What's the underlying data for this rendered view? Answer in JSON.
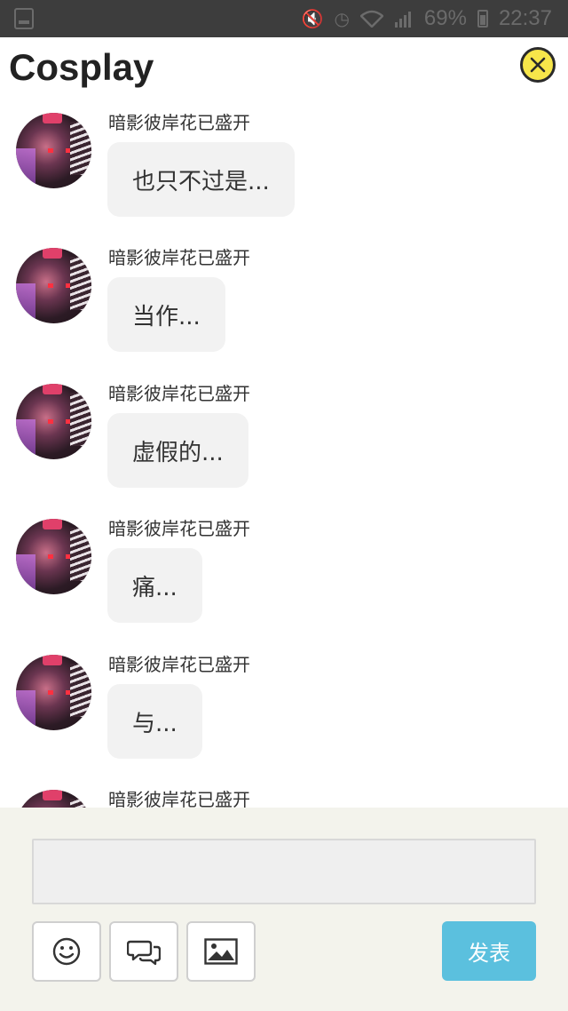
{
  "status_bar": {
    "battery": "69%",
    "time": "22:37",
    "icons": [
      "screenshot-icon",
      "mute-icon",
      "alarm-icon",
      "wifi-icon",
      "signal-icon",
      "battery-icon"
    ]
  },
  "header": {
    "title": "Cosplay",
    "close_icon": "close-icon",
    "accent_color": "#f7e64a"
  },
  "messages": [
    {
      "author": "暗影彼岸花已盛开",
      "text": "也只不过是..."
    },
    {
      "author": "暗影彼岸花已盛开",
      "text": "当作..."
    },
    {
      "author": "暗影彼岸花已盛开",
      "text": "虚假的..."
    },
    {
      "author": "暗影彼岸花已盛开",
      "text": "痛..."
    },
    {
      "author": "暗影彼岸花已盛开",
      "text": "与..."
    },
    {
      "author": "暗影彼岸花已盛开",
      "text": ""
    }
  ],
  "composer": {
    "input_value": "",
    "tools": [
      "emoji-icon",
      "comment-icon",
      "image-icon"
    ],
    "send_label": "发表",
    "send_color": "#5bc0de"
  }
}
